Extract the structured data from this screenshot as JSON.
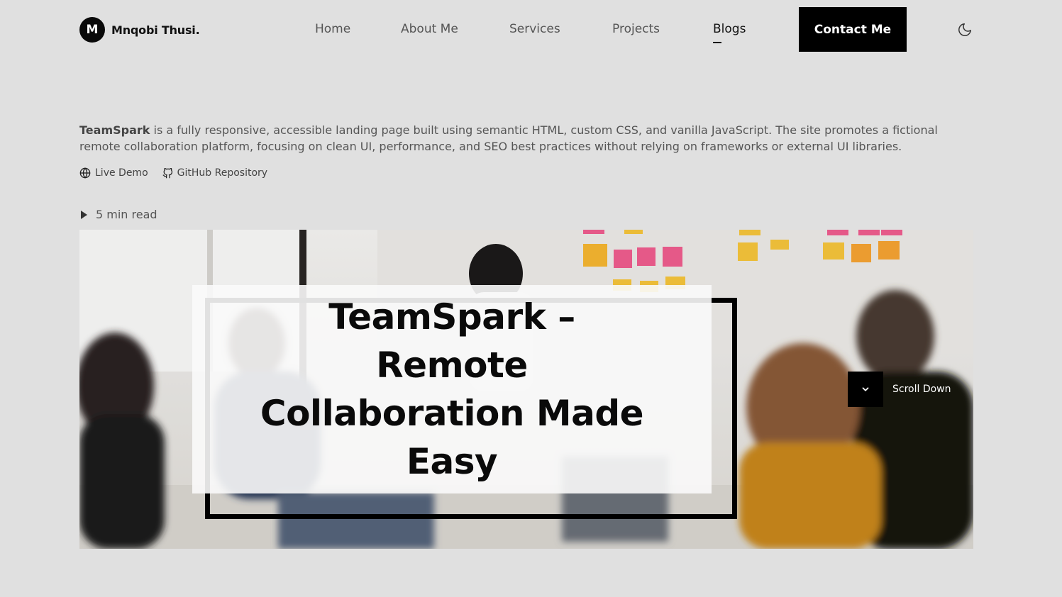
{
  "brand": {
    "initial": "M",
    "name": "Mnqobi Thusi."
  },
  "nav": {
    "items": [
      {
        "label": "Home"
      },
      {
        "label": "About Me"
      },
      {
        "label": "Services"
      },
      {
        "label": "Projects"
      },
      {
        "label": "Blogs",
        "active": true
      }
    ],
    "contact_label": "Contact Me",
    "theme_icon": "moon-icon"
  },
  "post": {
    "desc_strong": "TeamSpark",
    "desc_rest": " is a fully responsive, accessible landing page built using semantic HTML, custom CSS, and vanilla JavaScript. The site promotes a fictional remote collaboration platform, focusing on clean UI, performance, and SEO best practices without relying on frameworks or external UI libraries.",
    "links": [
      {
        "label": "Live Demo",
        "icon": "globe-icon"
      },
      {
        "label": "GitHub Repository",
        "icon": "github-icon"
      }
    ],
    "read_time": "5 min read"
  },
  "hero": {
    "title": "TeamSpark – Remote Collaboration Made Easy",
    "scroll_label": "Scroll Down"
  },
  "colors": {
    "background": "#e0e0e0",
    "accent": "#000000",
    "text": "#1a1a1a",
    "muted": "#555555"
  }
}
